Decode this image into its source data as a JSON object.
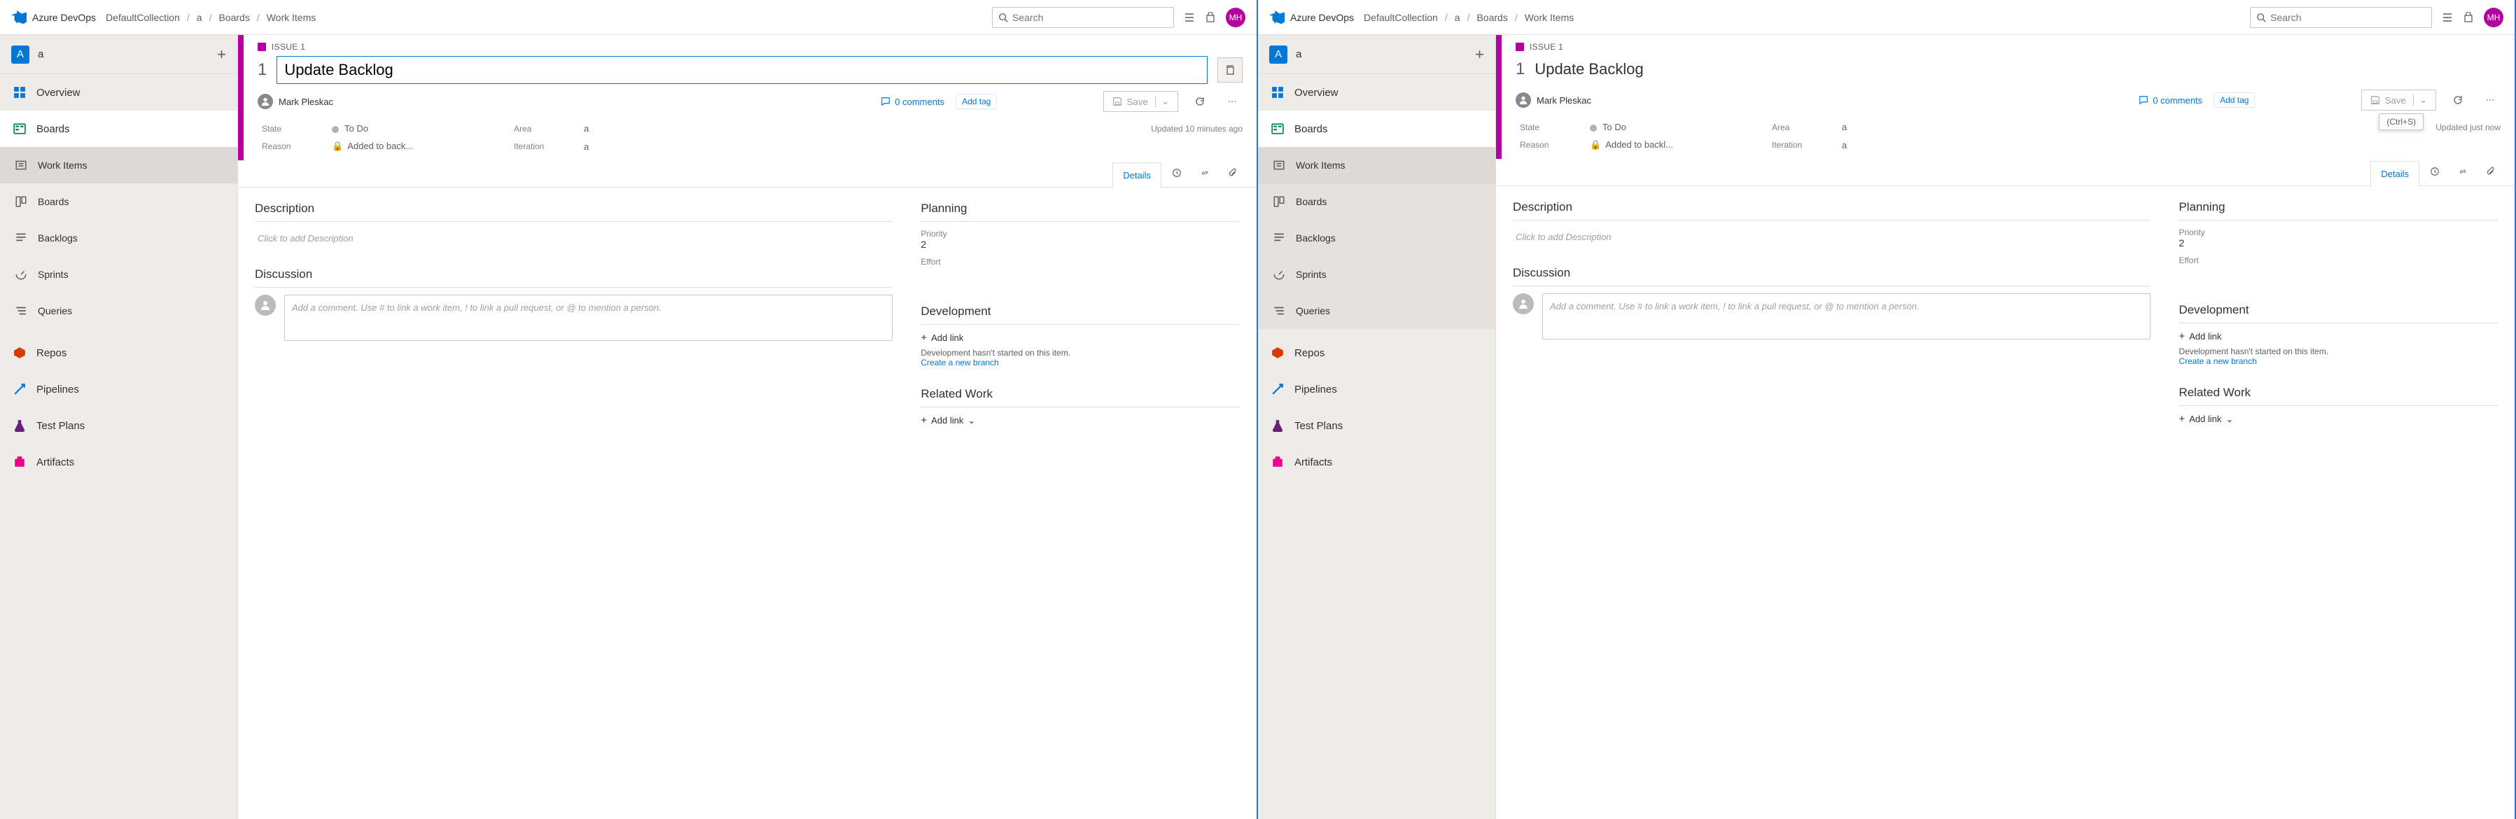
{
  "brand": "Azure DevOps",
  "breadcrumbs": [
    "DefaultCollection",
    "a",
    "Boards",
    "Work Items"
  ],
  "search_placeholder": "Search",
  "avatar_initials": "MH",
  "project": {
    "badge": "A",
    "name": "a"
  },
  "nav": {
    "overview": "Overview",
    "boards": "Boards",
    "work_items": "Work Items",
    "boards_sub": "Boards",
    "backlogs": "Backlogs",
    "sprints": "Sprints",
    "queries": "Queries",
    "repos": "Repos",
    "pipelines": "Pipelines",
    "test_plans": "Test Plans",
    "artifacts": "Artifacts"
  },
  "issue": {
    "type_label": "ISSUE 1",
    "number": "1",
    "title": "Update Backlog",
    "assignee": "Mark Pleskac",
    "comments": "0 comments",
    "add_tag": "Add tag",
    "save": "Save",
    "state_lbl": "State",
    "state_val": "To Do",
    "area_lbl": "Area",
    "area_val": "a",
    "reason_lbl": "Reason",
    "reason_val": "Added to back...",
    "reason_val2": "Added to backl...",
    "iter_lbl": "Iteration",
    "iter_val": "a",
    "updated_left": "Updated 10 minutes ago",
    "updated_right": "Updated just now",
    "save_tooltip": "(Ctrl+S)"
  },
  "tabs": {
    "details": "Details"
  },
  "sections": {
    "description": "Description",
    "desc_placeholder": "Click to add Description",
    "discussion": "Discussion",
    "discuss_placeholder": "Add a comment. Use # to link a work item, ! to link a pull request, or @ to mention a person.",
    "planning": "Planning",
    "priority_lbl": "Priority",
    "priority_val": "2",
    "effort_lbl": "Effort",
    "development": "Development",
    "add_link": "Add link",
    "dev_note": "Development hasn't started on this item.",
    "new_branch": "Create a new branch",
    "related": "Related Work",
    "add_link_caret": "Add link"
  }
}
